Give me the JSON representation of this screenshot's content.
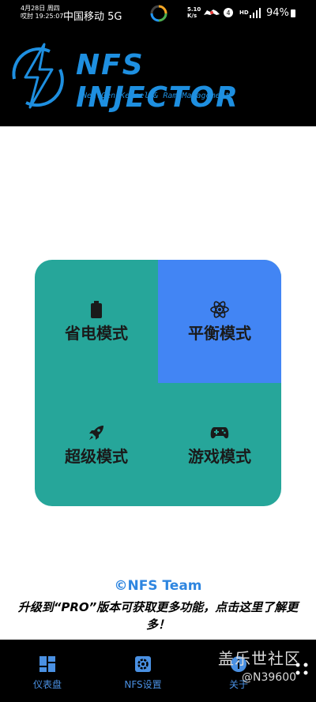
{
  "status_bar": {
    "date_line1": "4月28日 周四",
    "date_line2": "哎肘 19:25:07",
    "carrier": "中国移动 5G",
    "speed_line1": "5.10",
    "speed_line2": "K/s",
    "hd": "HD",
    "battery": "94%"
  },
  "banner": {
    "title": "NFS INJECTOR",
    "subtitle": "NextGen Kernel & Ram Management",
    "accent": "#1e8fe0"
  },
  "modes": [
    {
      "label": "省电模式",
      "icon": "battery-icon",
      "selected": false
    },
    {
      "label": "平衡模式",
      "icon": "atom-icon",
      "selected": true
    },
    {
      "label": "超级模式",
      "icon": "rocket-icon",
      "selected": false
    },
    {
      "label": "游戏模式",
      "icon": "gamepad-icon",
      "selected": false
    }
  ],
  "colors": {
    "tile": "#26a69a",
    "tile_selected": "#4285f4",
    "nav_accent": "#4a90e2"
  },
  "footer": {
    "copyright": "©NFS Team",
    "upgrade": "升级到“PRO”版本可获取更多功能，点击这里了解更多！"
  },
  "nav": [
    {
      "label": "仪表盘",
      "icon": "dashboard-icon"
    },
    {
      "label": "NFS设置",
      "icon": "settings-icon"
    },
    {
      "label": "关于",
      "icon": "info-icon"
    }
  ],
  "watermark": {
    "line1": "盖乐世社区",
    "line2": "@N39600"
  }
}
